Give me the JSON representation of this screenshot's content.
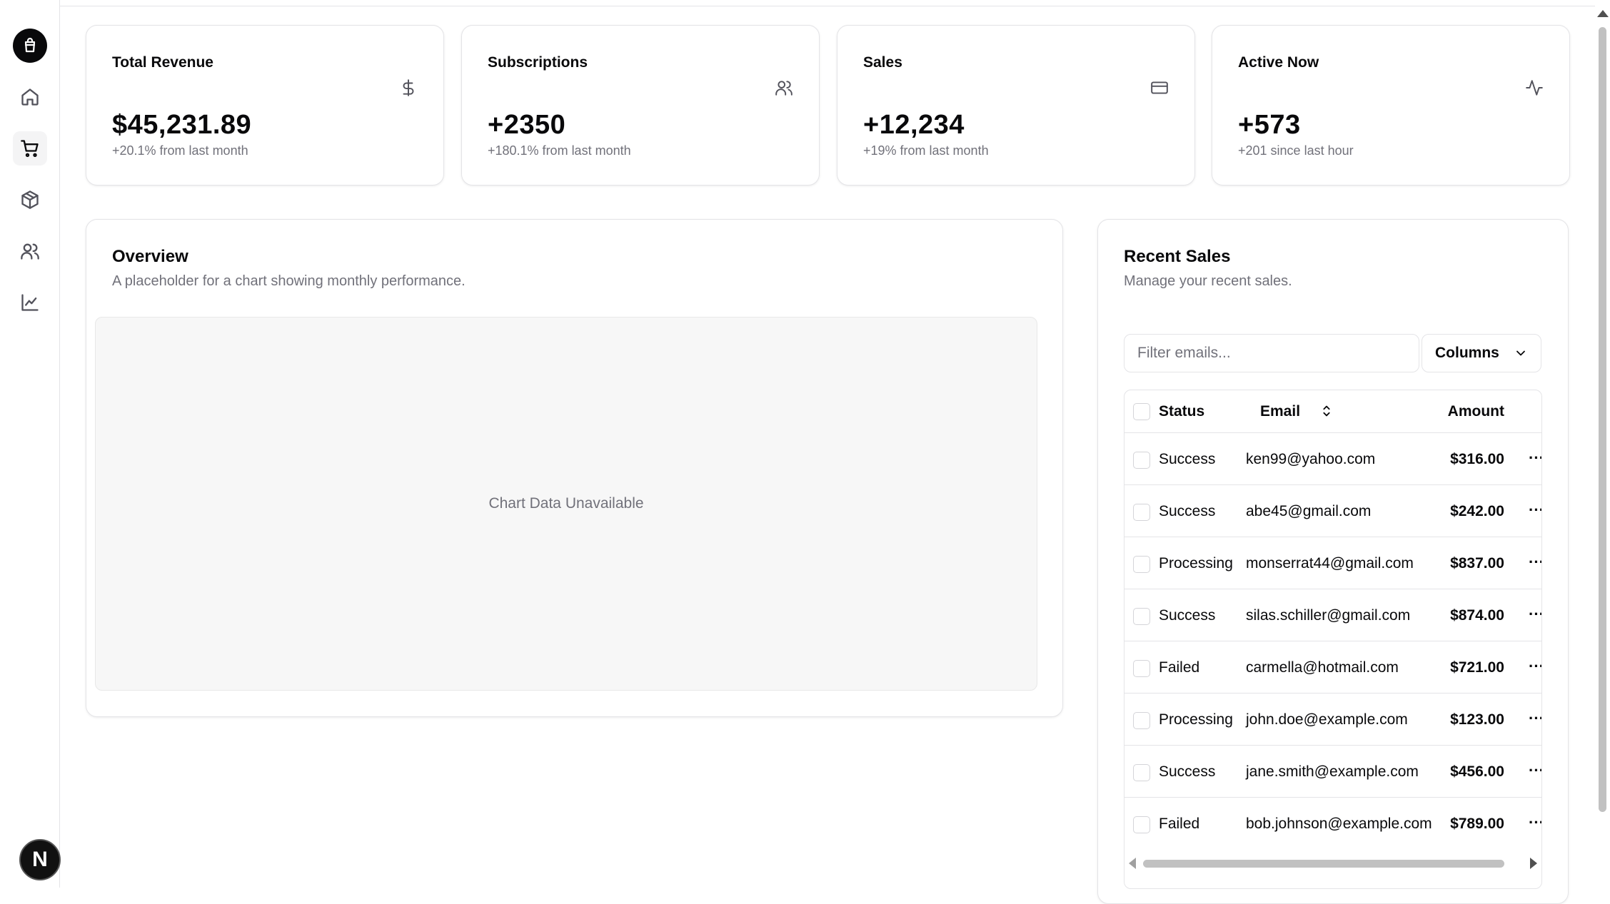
{
  "sidebar": {
    "brand_icon": "shopping-bag-icon",
    "items": [
      {
        "name": "home",
        "icon": "home-icon"
      },
      {
        "name": "orders",
        "icon": "shopping-cart-icon",
        "active": true
      },
      {
        "name": "products",
        "icon": "package-icon"
      },
      {
        "name": "customers",
        "icon": "users-icon"
      },
      {
        "name": "analytics",
        "icon": "line-chart-icon"
      }
    ],
    "badge_letter": "N"
  },
  "stats": [
    {
      "title": "Total Revenue",
      "value": "$45,231.89",
      "sub": "+20.1% from last month",
      "icon": "dollar-icon"
    },
    {
      "title": "Subscriptions",
      "value": "+2350",
      "sub": "+180.1% from last month",
      "icon": "users-icon"
    },
    {
      "title": "Sales",
      "value": "+12,234",
      "sub": "+19% from last month",
      "icon": "credit-card-icon"
    },
    {
      "title": "Active Now",
      "value": "+573",
      "sub": "+201 since last hour",
      "icon": "activity-icon"
    }
  ],
  "overview": {
    "title": "Overview",
    "description": "A placeholder for a chart showing monthly performance.",
    "chart_placeholder": "Chart Data Unavailable"
  },
  "recent_sales": {
    "title": "Recent Sales",
    "description": "Manage your recent sales.",
    "filter_placeholder": "Filter emails...",
    "filter_value": "",
    "columns_label": "Columns",
    "headers": {
      "status": "Status",
      "email": "Email",
      "amount": "Amount"
    },
    "rows": [
      {
        "status": "Success",
        "email": "ken99@yahoo.com",
        "amount": "$316.00"
      },
      {
        "status": "Success",
        "email": "abe45@gmail.com",
        "amount": "$242.00"
      },
      {
        "status": "Processing",
        "email": "monserrat44@gmail.com",
        "amount": "$837.00"
      },
      {
        "status": "Success",
        "email": "silas.schiller@gmail.com",
        "amount": "$874.00"
      },
      {
        "status": "Failed",
        "email": "carmella@hotmail.com",
        "amount": "$721.00"
      },
      {
        "status": "Processing",
        "email": "john.doe@example.com",
        "amount": "$123.00"
      },
      {
        "status": "Success",
        "email": "jane.smith@example.com",
        "amount": "$456.00"
      },
      {
        "status": "Failed",
        "email": "bob.johnson@example.com",
        "amount": "$789.00"
      }
    ],
    "row_action": "···"
  }
}
